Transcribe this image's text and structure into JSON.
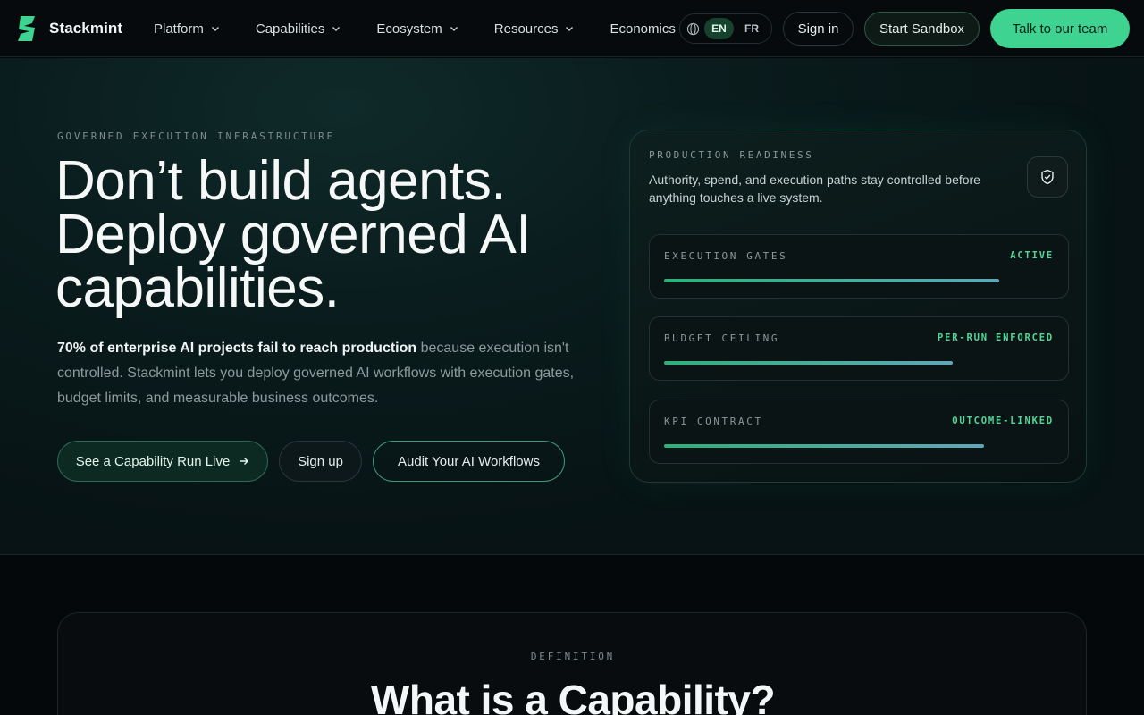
{
  "brand": {
    "name": "Stackmint",
    "logo_icon": "stackmint-logo-icon",
    "accent": "#3fd392"
  },
  "nav": {
    "items": [
      {
        "label": "Platform",
        "has_dropdown": true
      },
      {
        "label": "Capabilities",
        "has_dropdown": true
      },
      {
        "label": "Ecosystem",
        "has_dropdown": true
      },
      {
        "label": "Resources",
        "has_dropdown": true
      },
      {
        "label": "Economics",
        "has_dropdown": false
      }
    ],
    "language": {
      "active": "EN",
      "other": "FR",
      "icon": "globe-icon"
    },
    "sign_in": "Sign in",
    "start_sandbox": "Start Sandbox",
    "talk_to_team": "Talk to our team"
  },
  "hero": {
    "eyebrow": "GOVERNED EXECUTION INFRASTRUCTURE",
    "headline_line1": "Don’t build agents.",
    "headline_line2": "Deploy governed AI",
    "headline_line3": "capabilities.",
    "sub_strong": "70% of enterprise AI projects fail to reach production",
    "sub_rest": " because execution isn't controlled. Stackmint lets you deploy governed AI workflows with execution gates, budget limits, and measurable business outcomes.",
    "cta_primary": "See a Capability Run Live",
    "cta_signup": "Sign up",
    "cta_audit": "Audit Your AI Workflows"
  },
  "readiness_card": {
    "eyebrow": "PRODUCTION READINESS",
    "description": "Authority, spend, and execution paths stay controlled before anything touches a live system.",
    "icon": "shield-check-icon",
    "metrics": [
      {
        "label": "EXECUTION GATES",
        "status": "ACTIVE",
        "progress": 0.86
      },
      {
        "label": "BUDGET CEILING",
        "status": "PER-RUN ENFORCED",
        "progress": 0.74
      },
      {
        "label": "KPI CONTRACT",
        "status": "OUTCOME-LINKED",
        "progress": 0.82
      }
    ]
  },
  "definition": {
    "eyebrow": "DEFINITION",
    "title": "What is a Capability?"
  }
}
